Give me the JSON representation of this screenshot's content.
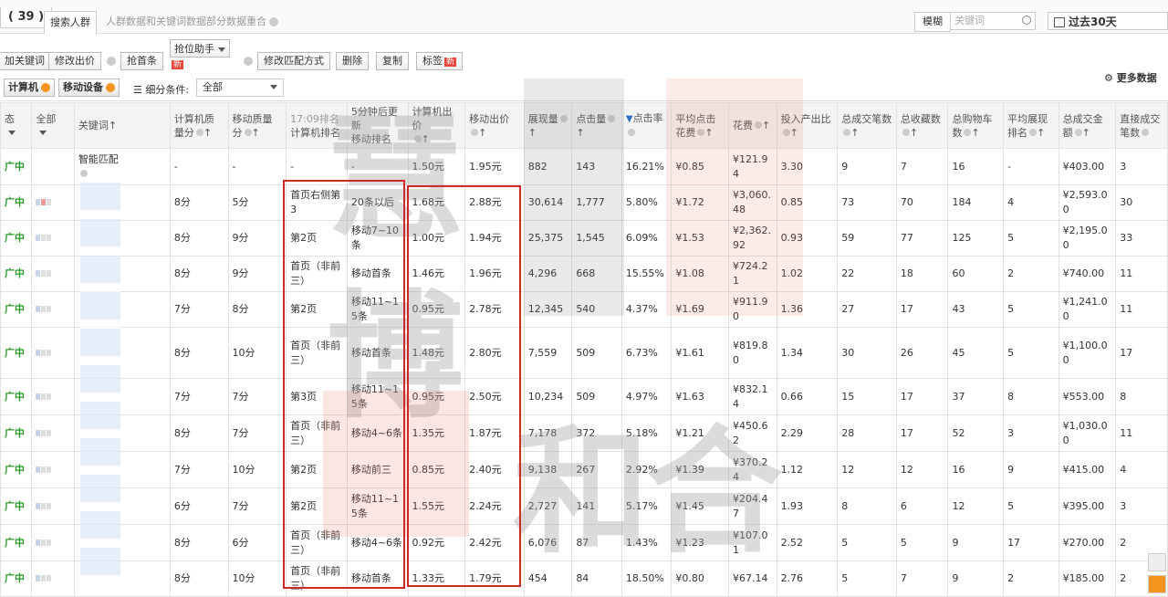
{
  "header": {
    "count": "( 39 )",
    "tab_search": "搜索人群",
    "tab_info": "人群数据和关键词数据部分数据重合",
    "fuzzy": "模糊",
    "keyword_placeholder": "关键词",
    "date_range": "过去30天"
  },
  "toolbar": {
    "add_keyword": "加关键词",
    "modify_bid": "修改出价",
    "grab_first": "抢首条",
    "robber_assistant": "抢位助手",
    "new_badge": "新",
    "modify_match": "修改匹配方式",
    "delete": "删除",
    "copy": "复制",
    "tag": "标签",
    "more_data": "更多数据"
  },
  "filter": {
    "computer": "计算机",
    "mobile": "移动设备",
    "sub_condition": "细分条件:",
    "all": "全部"
  },
  "columns": {
    "status": "态",
    "all": "全部",
    "keyword": "关键词",
    "pc_quality": "计算机质量分",
    "mobile_quality": "移动质量分",
    "time_label": "17:09排名",
    "pc_rank": "计算机排名",
    "refresh_label": "5分钟后更新",
    "mobile_rank": "移动排名",
    "pc_bid": "计算机出价",
    "mobile_bid": "移动出价",
    "impressions": "展现量",
    "clicks": "点击量",
    "ctr": "点击率",
    "avg_cpc": "平均点击花费",
    "cost": "花费",
    "roi": "投入产出比",
    "total_orders": "总成交笔数",
    "favorites": "总收藏数",
    "cart": "总购物车数",
    "avg_rank": "平均展现排名",
    "total_amount": "总成交金额",
    "direct_orders": "直接成交笔数"
  },
  "rows": [
    {
      "status": "广中",
      "keyword": "智能匹配",
      "pcq": "-",
      "mq": "-",
      "pcr": "-",
      "mr": "-",
      "pcb": "1.50元",
      "mb": "1.95元",
      "imp": "882",
      "clk": "143",
      "ctr": "16.21%",
      "cpc": "¥0.85",
      "cost": "¥121.94",
      "roi": "3.30",
      "orders": "9",
      "fav": "7",
      "cart": "16",
      "avgr": "-",
      "amt": "¥403.00",
      "direct": "3"
    },
    {
      "status": "广中",
      "keyword": "",
      "pcq": "8分",
      "mq": "5分",
      "pcr": "首页右侧第3",
      "mr": "20条以后",
      "pcb": "1.68元",
      "mb": "2.88元",
      "imp": "30,614",
      "clk": "1,777",
      "ctr": "5.80%",
      "cpc": "¥1.72",
      "cost": "¥3,060.48",
      "roi": "0.85",
      "orders": "73",
      "fav": "70",
      "cart": "184",
      "avgr": "4",
      "amt": "¥2,593.00",
      "direct": "30"
    },
    {
      "status": "广中",
      "keyword": "",
      "pcq": "8分",
      "mq": "9分",
      "pcr": "第2页",
      "mr": "移动7~10条",
      "pcb": "1.00元",
      "mb": "1.94元",
      "imp": "25,375",
      "clk": "1,545",
      "ctr": "6.09%",
      "cpc": "¥1.53",
      "cost": "¥2,362.92",
      "roi": "0.93",
      "orders": "59",
      "fav": "77",
      "cart": "125",
      "avgr": "5",
      "amt": "¥2,195.00",
      "direct": "33"
    },
    {
      "status": "广中",
      "keyword": "",
      "pcq": "8分",
      "mq": "9分",
      "pcr": "首页（非前三）",
      "mr": "移动首条",
      "pcb": "1.46元",
      "mb": "1.96元",
      "imp": "4,296",
      "clk": "668",
      "ctr": "15.55%",
      "cpc": "¥1.08",
      "cost": "¥724.21",
      "roi": "1.02",
      "orders": "22",
      "fav": "18",
      "cart": "60",
      "avgr": "2",
      "amt": "¥740.00",
      "direct": "11"
    },
    {
      "status": "广中",
      "keyword": "",
      "pcq": "7分",
      "mq": "8分",
      "pcr": "第2页",
      "mr": "移动11~15条",
      "pcb": "0.95元",
      "mb": "2.78元",
      "imp": "12,345",
      "clk": "540",
      "ctr": "4.37%",
      "cpc": "¥1.69",
      "cost": "¥911.90",
      "roi": "1.36",
      "orders": "27",
      "fav": "17",
      "cart": "43",
      "avgr": "5",
      "amt": "¥1,241.00",
      "direct": "11"
    },
    {
      "status": "广中",
      "keyword": "",
      "pcq": "8分",
      "mq": "10分",
      "pcr": "首页（非前三）",
      "mr": "移动首条",
      "pcb": "1.48元",
      "mb": "2.80元",
      "imp": "7,559",
      "clk": "509",
      "ctr": "6.73%",
      "cpc": "¥1.61",
      "cost": "¥819.80",
      "roi": "1.34",
      "orders": "30",
      "fav": "26",
      "cart": "45",
      "avgr": "5",
      "amt": "¥1,100.00",
      "direct": "17"
    },
    {
      "status": "广中",
      "keyword": "",
      "pcq": "7分",
      "mq": "7分",
      "pcr": "第3页",
      "mr": "移动11~15条",
      "pcb": "0.95元",
      "mb": "2.50元",
      "imp": "10,234",
      "clk": "509",
      "ctr": "4.97%",
      "cpc": "¥1.63",
      "cost": "¥832.14",
      "roi": "0.66",
      "orders": "15",
      "fav": "17",
      "cart": "37",
      "avgr": "8",
      "amt": "¥553.00",
      "direct": "8"
    },
    {
      "status": "广中",
      "keyword": "",
      "pcq": "8分",
      "mq": "7分",
      "pcr": "首页（非前三）",
      "mr": "移动4~6条",
      "pcb": "1.35元",
      "mb": "1.87元",
      "imp": "7,178",
      "clk": "372",
      "ctr": "5.18%",
      "cpc": "¥1.21",
      "cost": "¥450.62",
      "roi": "2.29",
      "orders": "28",
      "fav": "17",
      "cart": "52",
      "avgr": "3",
      "amt": "¥1,030.00",
      "direct": "11"
    },
    {
      "status": "广中",
      "keyword": "",
      "pcq": "7分",
      "mq": "10分",
      "pcr": "第2页",
      "mr": "移动前三",
      "pcb": "0.85元",
      "mb": "2.40元",
      "imp": "9,138",
      "clk": "267",
      "ctr": "2.92%",
      "cpc": "¥1.39",
      "cost": "¥370.24",
      "roi": "1.12",
      "orders": "12",
      "fav": "12",
      "cart": "16",
      "avgr": "9",
      "amt": "¥415.00",
      "direct": "4"
    },
    {
      "status": "广中",
      "keyword": "",
      "pcq": "6分",
      "mq": "7分",
      "pcr": "第2页",
      "mr": "移动11~15条",
      "pcb": "1.55元",
      "mb": "2.24元",
      "imp": "2,727",
      "clk": "141",
      "ctr": "5.17%",
      "cpc": "¥1.45",
      "cost": "¥204.47",
      "roi": "1.93",
      "orders": "8",
      "fav": "6",
      "cart": "12",
      "avgr": "5",
      "amt": "¥395.00",
      "direct": "3"
    },
    {
      "status": "广中",
      "keyword": "",
      "pcq": "8分",
      "mq": "6分",
      "pcr": "首页（非前三）",
      "mr": "移动4~6条",
      "pcb": "0.92元",
      "mb": "2.42元",
      "imp": "6,076",
      "clk": "87",
      "ctr": "1.43%",
      "cpc": "¥1.23",
      "cost": "¥107.01",
      "roi": "2.52",
      "orders": "5",
      "fav": "5",
      "cart": "9",
      "avgr": "17",
      "amt": "¥270.00",
      "direct": "2"
    },
    {
      "status": "广中",
      "keyword": "",
      "pcq": "8分",
      "mq": "10分",
      "pcr": "首页（非前三）",
      "mr": "移动首条",
      "pcb": "1.33元",
      "mb": "1.79元",
      "imp": "454",
      "clk": "84",
      "ctr": "18.50%",
      "cpc": "¥0.80",
      "cost": "¥67.14",
      "roi": "2.76",
      "orders": "5",
      "fav": "7",
      "cart": "9",
      "avgr": "2",
      "amt": "¥185.00",
      "direct": "2"
    }
  ],
  "watermark": {
    "chars": [
      "慧",
      "博",
      "和",
      "合"
    ]
  }
}
